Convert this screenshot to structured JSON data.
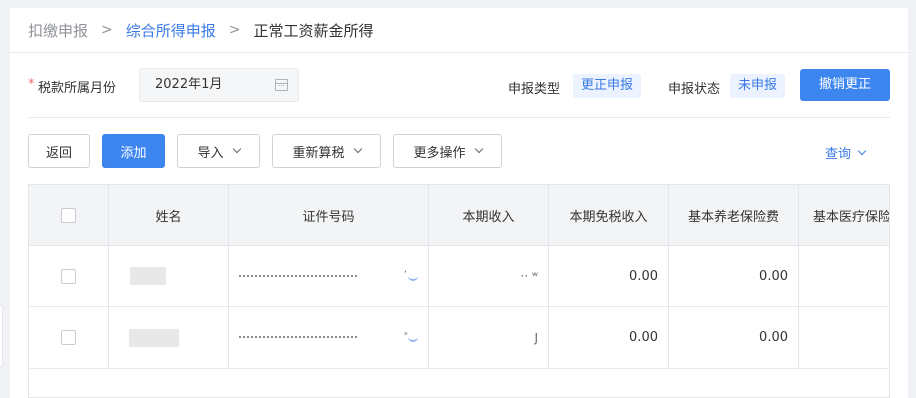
{
  "breadcrumb": {
    "root": "扣缴申报",
    "parent": "综合所得申报",
    "current": "正常工资薪金所得",
    "separator": ">"
  },
  "filter": {
    "required_mark": "*",
    "month_label": "税款所属月份",
    "month_value": "2022年1月",
    "type_label": "申报类型",
    "type_value": "更正申报",
    "status_label": "申报状态",
    "status_value": "未申报",
    "revoke_label": "撤销更正"
  },
  "toolbar": {
    "back": "返回",
    "add": "添加",
    "import": "导入",
    "recalc": "重新算税",
    "more": "更多操作",
    "query": "查询"
  },
  "table": {
    "headers": [
      "姓名",
      "证件号码",
      "本期收入",
      "本期免税收入",
      "基本养老保险费",
      "基本医疗保险"
    ],
    "rows": [
      {
        "income": "·· ʷ",
        "id_end": "ʻ",
        "exempt": "0.00",
        "pension": "0.00"
      },
      {
        "income": "J",
        "id_end": "ᵊ",
        "exempt": "0.00",
        "pension": "0.00"
      }
    ]
  },
  "colors": {
    "accent": "#3d86f0",
    "link": "#3a7ae8",
    "tag_bg": "#ecf3fe"
  }
}
